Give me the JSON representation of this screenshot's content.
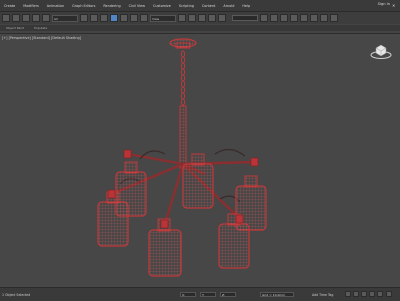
{
  "menu": {
    "items": [
      "Create",
      "Modifiers",
      "Animation",
      "Graph Editors",
      "Rendering",
      "Civil View",
      "Customize",
      "Scripting",
      "Content",
      "Arnold",
      "Help"
    ],
    "sign_in": "Sign In"
  },
  "toolbar": {
    "view_select": "View",
    "selection_set": ""
  },
  "ribbon": {
    "labels": [
      "Object Paint",
      "Populate"
    ]
  },
  "viewport": {
    "label": "[+] [Perspective] [Standard] [Default Shading]",
    "object_color": "#c0393b"
  },
  "statusbar": {
    "text": "1 Object Selected",
    "x": "X:",
    "y": "Y:",
    "z": "Z:",
    "grid": "Grid = 10.0mm",
    "add_time_tag": "Add Time Tag"
  },
  "colors": {
    "accent": "#4f86c6",
    "wireframe": "#c0393b"
  }
}
